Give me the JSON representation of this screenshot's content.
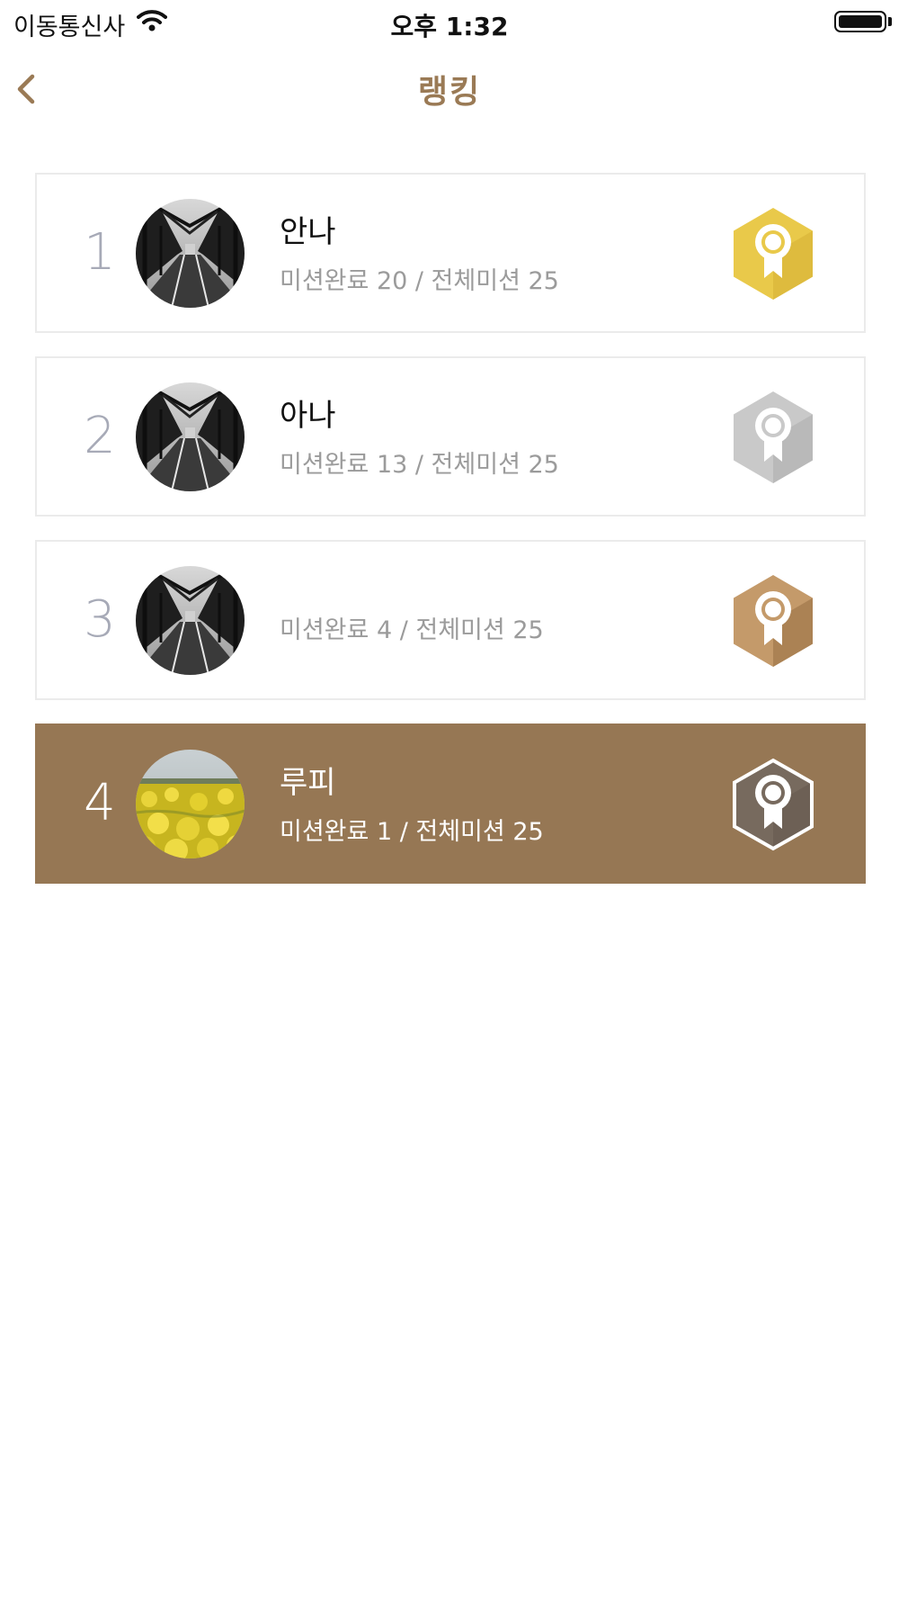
{
  "status_bar": {
    "carrier": "이동통신사",
    "time": "오후 1:32"
  },
  "nav": {
    "title": "랭킹",
    "back_icon": "chevron-left-icon"
  },
  "colors": {
    "accent": "#967754",
    "gold": "#e9c94a",
    "silver": "#c3c3c3",
    "bronze": "#c09568",
    "me_medal": "#7a6b5d"
  },
  "ranking": [
    {
      "rank": "1",
      "name": "안나",
      "mission": "미션완료 20 / 전체미션 25",
      "medal": "gold-medal-icon",
      "avatar": "bridge-photo",
      "highlight": false
    },
    {
      "rank": "2",
      "name": "아나",
      "mission": "미션완료 13 / 전체미션 25",
      "medal": "silver-medal-icon",
      "avatar": "bridge-photo",
      "highlight": false
    },
    {
      "rank": "3",
      "name": "",
      "mission": "미션완료 4 / 전체미션 25",
      "medal": "bronze-medal-icon",
      "avatar": "bridge-photo",
      "highlight": false
    },
    {
      "rank": "4",
      "name": "루피",
      "mission": "미션완료 1 / 전체미션 25",
      "medal": "my-medal-icon",
      "avatar": "flower-field-photo",
      "highlight": true
    }
  ]
}
